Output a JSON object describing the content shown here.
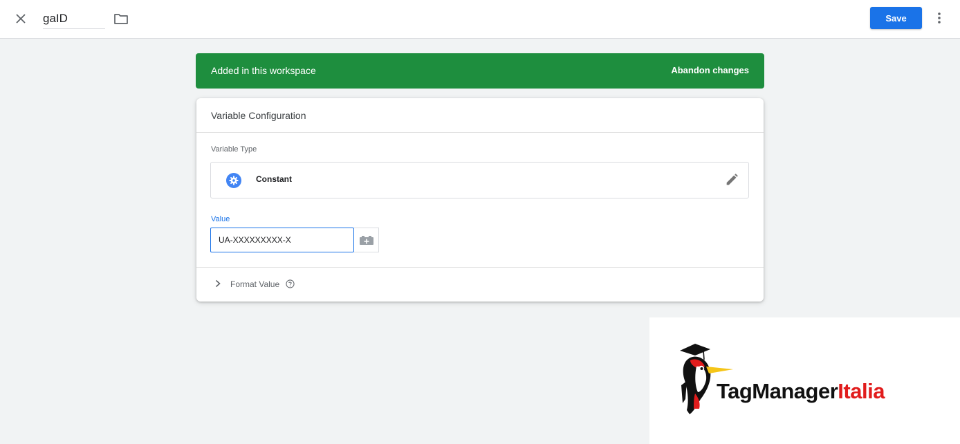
{
  "header": {
    "variable_name": "gaID",
    "save_label": "Save",
    "icons": {
      "close": "close-icon",
      "folder": "folder-icon",
      "more": "more-vert-icon"
    }
  },
  "banner": {
    "text": "Added in this workspace",
    "action_label": "Abandon changes",
    "color": "#1e8e3e"
  },
  "config": {
    "title": "Variable Configuration",
    "variable_type_label": "Variable Type",
    "variable_type": "Constant",
    "value_label": "Value",
    "value": "UA-XXXXXXXXX-X",
    "format_value_label": "Format Value"
  },
  "logo": {
    "brand_part1": "TagManager",
    "brand_part2": "Italia"
  },
  "colors": {
    "accent": "#1a73e8",
    "banner": "#1e8e3e",
    "brand_red": "#e11c1c"
  }
}
